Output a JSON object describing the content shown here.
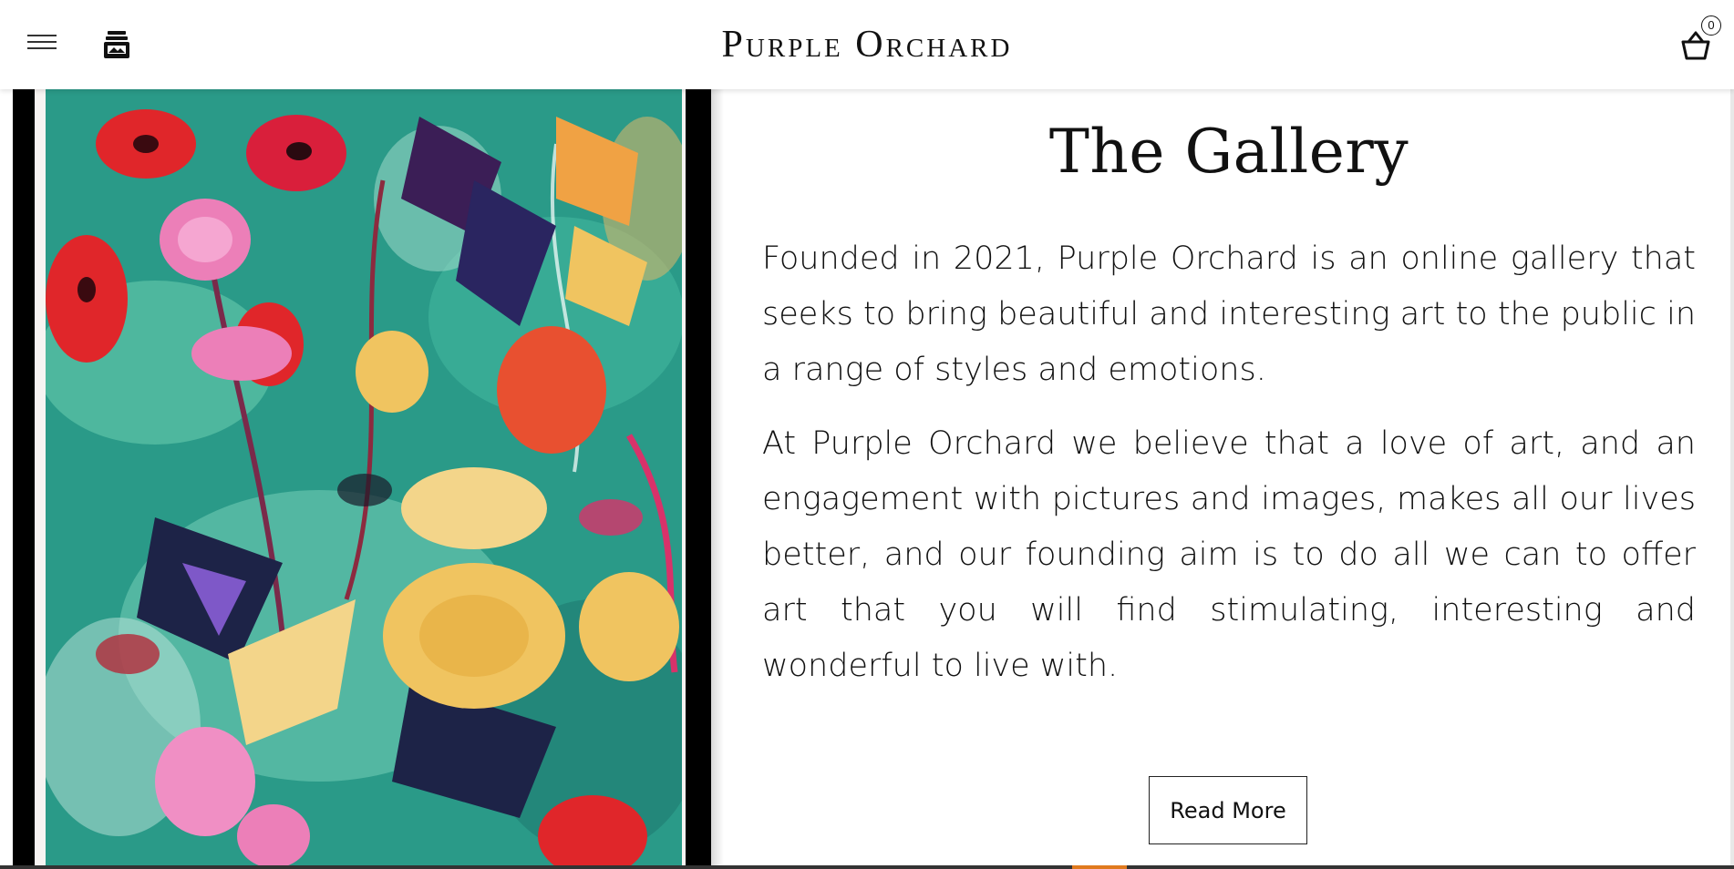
{
  "header": {
    "brand": "Purple Orchard",
    "menu_icon": "hamburger-menu-icon",
    "shop_icon": "shop-icon",
    "cart_icon": "basket-icon",
    "cart_count": "0"
  },
  "gallery": {
    "title": "The Gallery",
    "paragraphs": [
      "Founded in 2021, Purple Orchard is an online gallery that seeks to bring beautiful and interesting art to the public in a range of styles and emotions.",
      "At Purple Orchard we believe that a love of art, and an engagement with pictures and images, makes all our lives better, and our founding aim is to do all we can to offer art that you will find stimulating, interesting and wonderful to live with."
    ],
    "read_more_label": "Read More"
  },
  "colors": {
    "accent_orange": "#e07a1e",
    "painting_teal": "#2a9a88",
    "painting_red": "#e0262a",
    "painting_pink": "#ec7fb8",
    "painting_yellow": "#f0c460",
    "painting_navy": "#1d2347"
  }
}
